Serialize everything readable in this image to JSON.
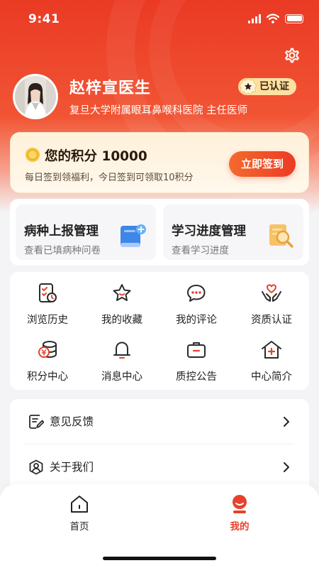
{
  "status_bar": {
    "time": "9:41"
  },
  "profile": {
    "name": "赵梓宣医生",
    "subtitle": "复旦大学附属眼耳鼻喉科医院 主任医师",
    "badge": "已认证"
  },
  "points": {
    "title": "您的积分 10000",
    "description": "每日签到领福利，今日签到可领取10积分",
    "signin_label": "立即签到"
  },
  "management": [
    {
      "title": "病种上报管理",
      "subtitle": "查看已填病种问卷",
      "icon": "book-icon"
    },
    {
      "title": "学习进度管理",
      "subtitle": "查看学习进度",
      "icon": "magnifier-document-icon"
    }
  ],
  "grid": [
    {
      "label": "浏览历史",
      "icon": "history-icon"
    },
    {
      "label": "我的收藏",
      "icon": "star-icon"
    },
    {
      "label": "我的评论",
      "icon": "comment-icon"
    },
    {
      "label": "资质认证",
      "icon": "hands-heart-icon"
    },
    {
      "label": "积分中心",
      "icon": "coins-icon"
    },
    {
      "label": "消息中心",
      "icon": "bell-icon"
    },
    {
      "label": "质控公告",
      "icon": "briefcase-icon"
    },
    {
      "label": "中心简介",
      "icon": "house-plus-icon"
    }
  ],
  "list": [
    {
      "label": "意见反馈",
      "icon": "feedback-edit-icon"
    },
    {
      "label": "关于我们",
      "icon": "user-circle-icon"
    }
  ],
  "tabbar": {
    "home_label": "首页",
    "mine_label": "我的"
  },
  "colors": {
    "accent": "#ec3b24",
    "badge_bg": "#ffe0a3",
    "icon_red": "#e8412c",
    "icon_dark": "#2a2a2a"
  }
}
